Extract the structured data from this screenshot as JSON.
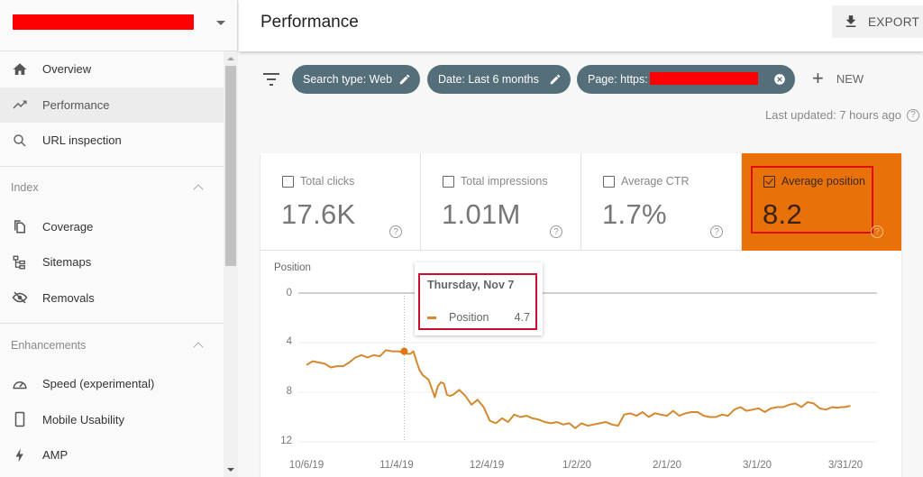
{
  "sidebar": {
    "property_selector": "[redacted]",
    "nav_top": [
      {
        "label": "Overview",
        "icon": "home-icon",
        "active": false
      },
      {
        "label": "Performance",
        "icon": "trending-up-icon",
        "active": true
      },
      {
        "label": "URL inspection",
        "icon": "search-icon",
        "active": false
      }
    ],
    "sections": [
      {
        "title": "Index",
        "items": [
          {
            "label": "Coverage",
            "icon": "copy-pages-icon"
          },
          {
            "label": "Sitemaps",
            "icon": "sitemap-icon"
          },
          {
            "label": "Removals",
            "icon": "visibility-off-icon"
          }
        ]
      },
      {
        "title": "Enhancements",
        "items": [
          {
            "label": "Speed (experimental)",
            "icon": "speedometer-icon"
          },
          {
            "label": "Mobile Usability",
            "icon": "smartphone-icon"
          },
          {
            "label": "AMP",
            "icon": "lightning-bolt-icon"
          }
        ]
      }
    ]
  },
  "header": {
    "title": "Performance",
    "export_label": "EXPORT"
  },
  "filters": {
    "chips": [
      {
        "label": "Search type: Web",
        "action": "edit"
      },
      {
        "label": "Date: Last 6 months",
        "action": "edit"
      },
      {
        "label": "Page: https:",
        "action": "remove",
        "redacted": true
      }
    ],
    "new_label": "NEW",
    "last_updated": "Last updated: 7 hours ago"
  },
  "metrics": [
    {
      "label": "Total clicks",
      "value": "17.6K",
      "checked": false
    },
    {
      "label": "Total impressions",
      "value": "1.01M",
      "checked": false
    },
    {
      "label": "Average CTR",
      "value": "1.7%",
      "checked": false
    },
    {
      "label": "Average position",
      "value": "8.2",
      "checked": true
    }
  ],
  "colors": {
    "accent_position": "#e8710a",
    "line": "#d6882e",
    "chip": "#546e7a",
    "annotation_red": "#e10b0b"
  },
  "tooltip": {
    "date": "Thursday, Nov 7",
    "series": "Position",
    "value": "4.7"
  },
  "chart_data": {
    "type": "line",
    "title": "",
    "ylabel": "Position",
    "xlabel": "",
    "ylim": [
      0,
      12
    ],
    "y_inverted": true,
    "yticks": [
      "0",
      "4",
      "8",
      "12"
    ],
    "xticks": [
      "10/6/19",
      "11/4/19",
      "12/4/19",
      "1/2/20",
      "2/1/20",
      "3/1/20",
      "3/31/20"
    ],
    "grid": true,
    "legend": "none",
    "series": [
      {
        "name": "Position",
        "x_days_from_oct6": [
          0,
          2,
          4,
          6,
          8,
          10,
          12,
          14,
          16,
          18,
          20,
          22,
          24,
          26,
          28,
          30,
          32,
          33,
          34,
          35,
          36,
          37,
          38,
          39,
          40,
          42,
          43,
          44,
          45,
          46,
          47,
          48,
          50,
          52,
          54,
          56,
          58,
          60,
          62,
          64,
          66,
          68,
          70,
          72,
          74,
          76,
          78,
          80,
          82,
          84,
          86,
          88,
          90,
          92,
          94,
          96,
          98,
          100,
          102,
          104,
          106,
          108,
          110,
          112,
          114,
          116,
          118,
          120,
          122,
          124,
          126,
          128,
          130,
          132,
          134,
          136,
          138,
          140,
          142,
          144,
          146,
          148,
          150,
          152,
          154,
          156,
          158,
          160,
          162,
          164,
          166,
          168,
          170,
          172,
          174,
          175,
          176,
          178
        ],
        "values": [
          5.8,
          5.5,
          5.6,
          5.7,
          6.0,
          5.9,
          5.9,
          5.6,
          5.2,
          5.0,
          5.2,
          5.0,
          5.1,
          4.6,
          4.7,
          4.7,
          4.8,
          4.9,
          4.9,
          4.7,
          5.5,
          6.2,
          6.6,
          6.8,
          7.0,
          8.4,
          7.5,
          7.2,
          7.3,
          8.2,
          8.3,
          8.2,
          7.8,
          8.3,
          9.0,
          8.6,
          9.2,
          10.3,
          10.5,
          10.1,
          10.4,
          9.8,
          10.0,
          9.9,
          10.1,
          10.2,
          10.4,
          10.5,
          10.4,
          10.6,
          10.5,
          10.9,
          10.5,
          10.7,
          10.6,
          10.5,
          10.4,
          10.6,
          10.7,
          9.8,
          9.7,
          9.9,
          9.6,
          10.0,
          9.7,
          9.8,
          9.9,
          9.5,
          9.9,
          9.7,
          9.6,
          9.6,
          9.9,
          10.0,
          10.0,
          9.8,
          9.9,
          9.4,
          9.2,
          9.5,
          9.4,
          9.3,
          9.6,
          9.3,
          9.2,
          9.2,
          9.0,
          8.9,
          9.2,
          8.8,
          8.9,
          9.3,
          9.4,
          9.2,
          9.25,
          9.2,
          9.2,
          9.1
        ],
        "highlight": {
          "x_day": 32,
          "label": "Nov 7",
          "value": 4.7
        }
      }
    ]
  }
}
